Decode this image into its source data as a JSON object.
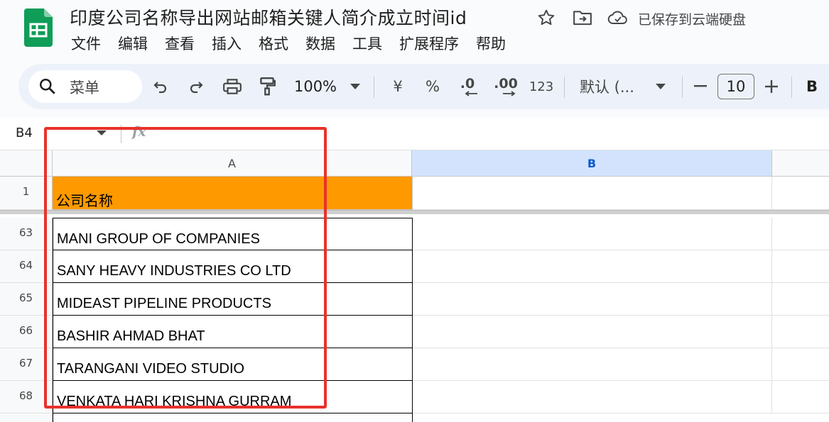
{
  "app": {
    "name": "Google Sheets",
    "logo_icon": "sheets-logo-icon"
  },
  "document": {
    "title": "印度公司名称导出网站邮箱关键人简介成立时间id",
    "save_status": "已保存到云端硬盘"
  },
  "menu": [
    "文件",
    "编辑",
    "查看",
    "插入",
    "格式",
    "数据",
    "工具",
    "扩展程序",
    "帮助"
  ],
  "toolbar": {
    "search_label": "菜单",
    "zoom": "100%",
    "currency": "¥",
    "percent": "%",
    "decrease_decimal": ".0",
    "increase_decimal": ".00",
    "number_format": "123",
    "font": "默认 (...",
    "font_size": "10",
    "bold": "B"
  },
  "formula_bar": {
    "cell_ref": "B4",
    "fx": "fx",
    "content": ""
  },
  "sheet": {
    "columns": [
      "A",
      "B"
    ],
    "selected_column": "B",
    "header_row": {
      "number": "1",
      "value": "公司名称",
      "fill": "#ff9900"
    },
    "rows": [
      {
        "number": "63",
        "value": "MANI GROUP OF COMPANIES"
      },
      {
        "number": "64",
        "value": "SANY HEAVY INDUSTRIES CO LTD"
      },
      {
        "number": "65",
        "value": "MIDEAST PIPELINE PRODUCTS"
      },
      {
        "number": "66",
        "value": "BASHIR AHMAD BHAT"
      },
      {
        "number": "67",
        "value": "TARANGANI VIDEO STUDIO"
      },
      {
        "number": "68",
        "value": "VENKATA HARI KRISHNA GURRAM"
      }
    ]
  },
  "colors": {
    "highlight": "#e8322b",
    "selected_header": "#d3e3fd",
    "accent": "#0b57d0"
  }
}
